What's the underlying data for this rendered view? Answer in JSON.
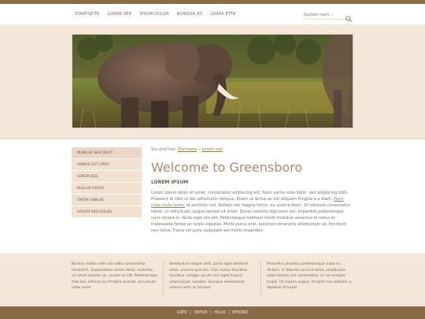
{
  "nav": {
    "items": [
      "Startseite",
      "Lorem sed",
      "Ipsum dolor",
      "Nunqua ed",
      "Loras etta"
    ]
  },
  "search": {
    "placeholder": "Suchen nach ..."
  },
  "sidebar": {
    "items": [
      {
        "label": "Nunque sed dolit"
      },
      {
        "label": "Vanius est oppo"
      },
      {
        "label": "Lorem sed"
      },
      {
        "label": "Nullus iquos"
      },
      {
        "label": "Entra vibilus"
      },
      {
        "label": "Holem sed dolda"
      }
    ]
  },
  "breadcrumb": {
    "prefix": "Sie sind hier:",
    "home": "Startseite",
    "sep": "»",
    "current": "Lorem sed"
  },
  "main": {
    "title": "Welcome to Greensboro",
    "section_title": "Lorem ipsum",
    "body_1": "Lorem ipsum dolor sit amet, consectetur adipiscing elit. Nunc varius eros dolor, sed adipiscing nibh. Praesent id nibh ut dui sollicitudin tempus. Etiam ut lectus ac elit aliquam fringilla a a diam. ",
    "body_hl": "Proin vitae nulla tortor,",
    "body_2": " at porttitor nisl. Nullam nec magna tortor, eu viverra diam. Ut vehicula consectetur tortor, ut sollicitudin augue laoreet sit amet. Donec lobortis dignissim est, imperdiet pellentesque nunc ornare in. Nulla eget nisl elit. Pellentesque habitant morbi tristique senectus et netus et malesuada fames ac turpis egestas. Morbi purus erat, euismod venenatis ullamcorper at, tincidunt non tellus. Fusce vel justo vulputate est mollis imperdiet."
  },
  "footer": {
    "col1": "Nullam mattis ante non odio consectetur hendrerit. Suspendisse lorem dolor, molestie sit amet sodales ac, auctor et elit. Pellentesque felis leo, ultrices eu fringilla laoreet, accumsan vitae enim",
    "col2": "Vestibulum neque velit, porta eget eleifend vitae, viverra quis leo. Cras varius faucibus faucibus. Integer iaculis nisl eget mauris ullamcorper sodales. Quisque elementum viverra ante ac tempor.",
    "col3": "Phasellus pharetra pellentesque nulla eu dictum. In lobortis urna id tellus vestibulum vitae lacinia nisl consectetur. In vel semper turpis. Ut sapien augue, fringilla non lobortis a, dapibus id turpis."
  },
  "bottom": {
    "links": [
      "Lopo",
      "Ontok",
      "Hulik",
      "Epsond"
    ],
    "sep": "|"
  },
  "colors": {
    "brand_brown": "#8b6b46",
    "background_beige": "#f4e7da",
    "title": "#b08a6a"
  }
}
